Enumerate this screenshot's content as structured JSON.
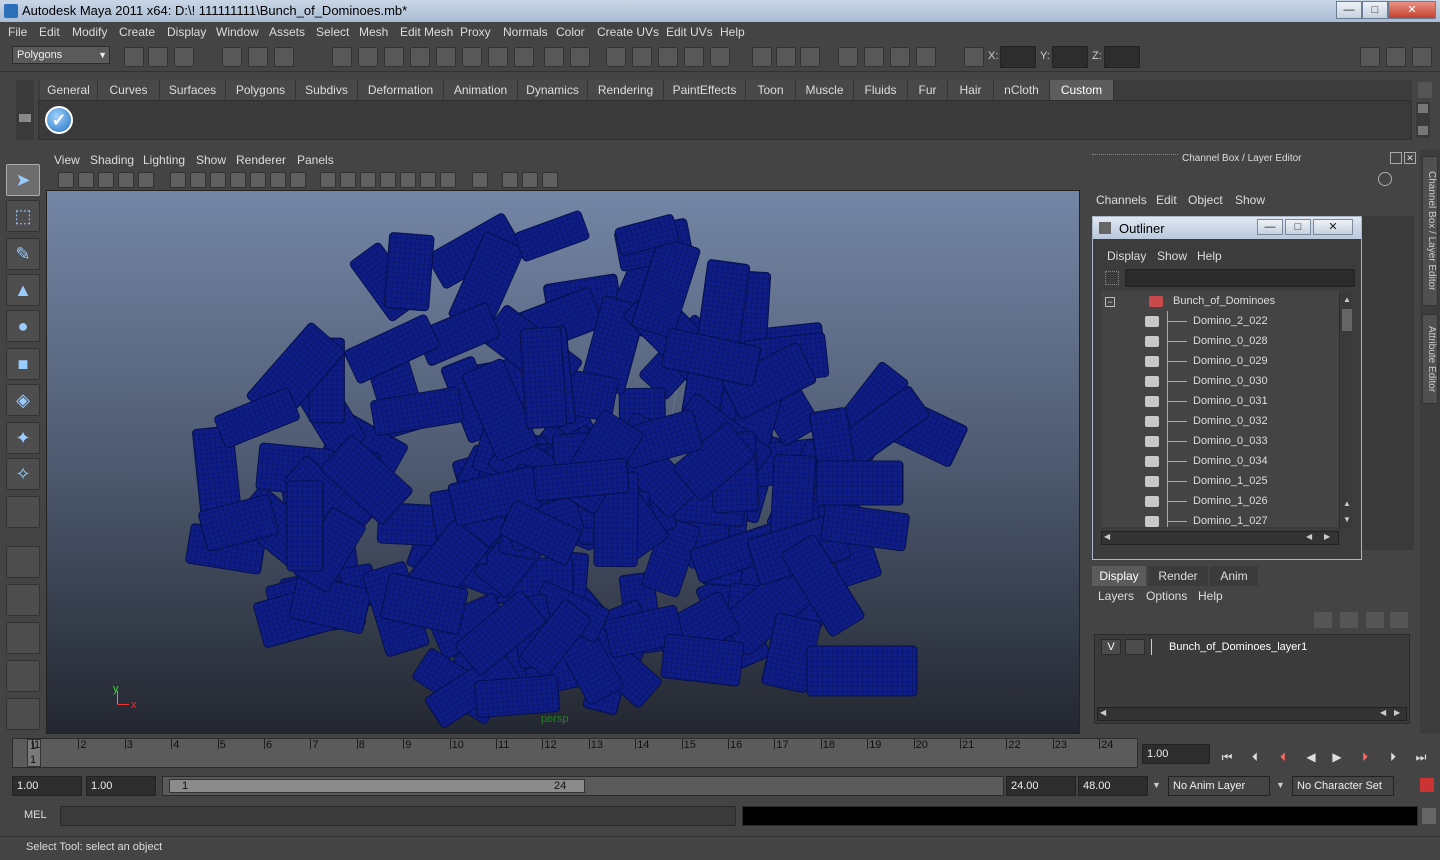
{
  "window": {
    "title": "Autodesk Maya 2011 x64: D:\\! 111111111\\Bunch_of_Dominoes.mb*"
  },
  "menubar": [
    "File",
    "Edit",
    "Modify",
    "Create",
    "Display",
    "Window",
    "Assets",
    "Select",
    "Mesh",
    "Edit Mesh",
    "Proxy",
    "Normals",
    "Color",
    "Create UVs",
    "Edit UVs",
    "Help"
  ],
  "status_line": {
    "mode": "Polygons",
    "x_label": "X:",
    "y_label": "Y:",
    "z_label": "Z:"
  },
  "shelf_tabs": [
    "General",
    "Curves",
    "Surfaces",
    "Polygons",
    "Subdivs",
    "Deformation",
    "Animation",
    "Dynamics",
    "Rendering",
    "PaintEffects",
    "Toon",
    "Muscle",
    "Fluids",
    "Fur",
    "Hair",
    "nCloth",
    "Custom"
  ],
  "shelf_active": "Custom",
  "viewport": {
    "menu": [
      "View",
      "Shading",
      "Lighting",
      "Show",
      "Renderer",
      "Panels"
    ],
    "camera": "persp",
    "axis_x": "x",
    "axis_y": "y"
  },
  "channel_box": {
    "title": "Channel Box / Layer Editor",
    "menu": [
      "Channels",
      "Edit",
      "Object",
      "Show"
    ]
  },
  "outliner": {
    "title": "Outliner",
    "menu": [
      "Display",
      "Show",
      "Help"
    ],
    "items": [
      "Bunch_of_Dominoes",
      "Domino_2_022",
      "Domino_0_028",
      "Domino_0_029",
      "Domino_0_030",
      "Domino_0_031",
      "Domino_0_032",
      "Domino_0_033",
      "Domino_0_034",
      "Domino_1_025",
      "Domino_1_026",
      "Domino_1_027"
    ]
  },
  "layer_editor": {
    "tabs": [
      "Display",
      "Render",
      "Anim"
    ],
    "menu": [
      "Layers",
      "Options",
      "Help"
    ],
    "visible_flag": "V",
    "layer_name": "Bunch_of_Dominoes_layer1"
  },
  "side_tabs": [
    "Channel Box / Layer Editor",
    "Attribute Editor"
  ],
  "timeline": {
    "ticks": [
      "1",
      "2",
      "3",
      "4",
      "5",
      "6",
      "7",
      "8",
      "9",
      "10",
      "11",
      "12",
      "13",
      "14",
      "15",
      "16",
      "17",
      "18",
      "19",
      "20",
      "21",
      "22",
      "23",
      "24"
    ],
    "current_frame": "1",
    "current_time_field": "1.00"
  },
  "range": {
    "start": "1.00",
    "playback_start": "1.00",
    "slider_start": "1",
    "slider_end": "24",
    "playback_end": "24.00",
    "end": "48.00",
    "anim_layer": "No Anim Layer",
    "character_set": "No Character Set"
  },
  "command_line": {
    "label": "MEL"
  },
  "help_line": {
    "text": "Select Tool: select an object"
  },
  "colors": {
    "viewport_top": "#7486a6",
    "viewport_bottom": "#232730",
    "wireframe": "#0d1a7a"
  }
}
